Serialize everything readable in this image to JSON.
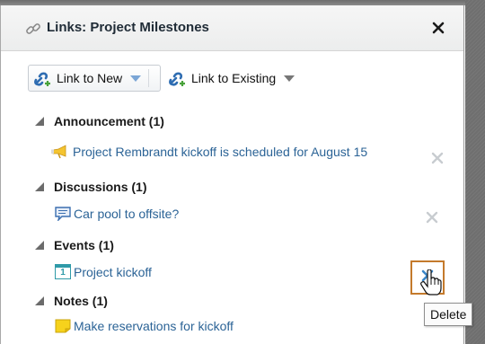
{
  "dialog": {
    "title": "Links: Project Milestones",
    "close_symbol": "✕"
  },
  "toolbar": {
    "link_new_label": "Link to New",
    "link_existing_label": "Link to Existing"
  },
  "sections": [
    {
      "heading": "Announcement (1)",
      "item_icon": "megaphone-icon",
      "item_label": "Project Rembrandt kickoff is scheduled for August 15"
    },
    {
      "heading": "Discussions (1)",
      "item_icon": "speech-bubble-icon",
      "item_label": "Car pool to offsite?"
    },
    {
      "heading": "Events (1)",
      "item_icon": "calendar-icon",
      "item_label": "Project kickoff",
      "calendar_day": "1"
    },
    {
      "heading": "Notes (1)",
      "item_icon": "sticky-note-icon",
      "item_label": "Make reservations for kickoff"
    }
  ],
  "tooltip": {
    "label": "Delete"
  },
  "colors": {
    "link": "#2b6396",
    "highlight_border": "#c47a2c",
    "remove_x_idle": "#c8ccd0",
    "remove_x_active": "#3a86c8"
  }
}
